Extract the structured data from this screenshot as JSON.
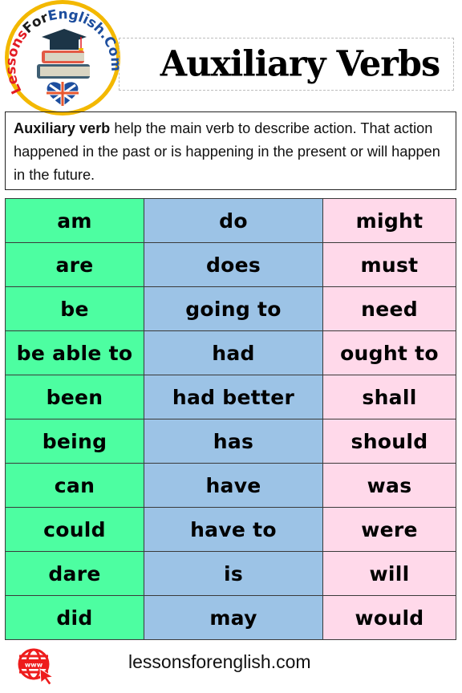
{
  "logo": {
    "text_left": "Lessons",
    "text_mid": "For",
    "text_right": "English.Com",
    "colors": {
      "ring": "#f3b800",
      "red": "#e31b23",
      "blue": "#1d4e9e",
      "dark": "#1c3547"
    }
  },
  "header": {
    "title": "Auxiliary Verbs"
  },
  "description": {
    "bold_term": "Auxiliary verb",
    "text": " help the main verb to describe action. That action happened in the past or is happening in the present or will happen in the future."
  },
  "table": {
    "column_colors": [
      "#4dfea1",
      "#9cc3e6",
      "#ffd9ea"
    ],
    "rows": [
      [
        "am",
        "do",
        "might"
      ],
      [
        "are",
        "does",
        "must"
      ],
      [
        "be",
        "going to",
        "need"
      ],
      [
        "be able to",
        "had",
        "ought to"
      ],
      [
        "been",
        "had better",
        "shall"
      ],
      [
        "being",
        "has",
        "should"
      ],
      [
        "can",
        "have",
        "was"
      ],
      [
        "could",
        "have to",
        "were"
      ],
      [
        "dare",
        "is",
        "will"
      ],
      [
        "did",
        "may",
        "would"
      ]
    ]
  },
  "footer": {
    "icon": "globe-www-cursor-icon",
    "icon_label": "www",
    "url": "lessonsforenglish.com",
    "icon_color": "#ee1c1c"
  }
}
